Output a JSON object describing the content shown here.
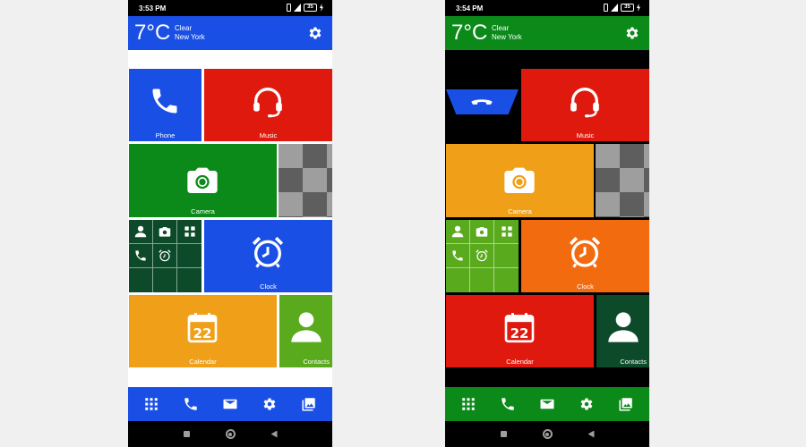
{
  "screens": [
    {
      "status": {
        "time": "3:53 PM",
        "battery": "35"
      },
      "weather": {
        "temp": "7°C",
        "condition": "Clear",
        "city": "New York"
      },
      "colors": {
        "header": "#1a4fe6",
        "content_bg": "#ffffff",
        "dock": "#1a4fe6"
      },
      "tiles": {
        "phone": "Phone",
        "music": "Music",
        "camera": "Camera",
        "clock": "Clock",
        "calendar": "Calendar",
        "contacts": "Contacts",
        "calendar_day": "22"
      }
    },
    {
      "status": {
        "time": "3:54 PM",
        "battery": "35"
      },
      "weather": {
        "temp": "7°C",
        "condition": "Clear",
        "city": "New York"
      },
      "colors": {
        "header": "#0b8a1a",
        "content_bg": "#000000",
        "dock": "#0b8a1a"
      },
      "tiles": {
        "music": "Music",
        "camera": "Camera",
        "clock": "Clock",
        "calendar": "Calendar",
        "contacts": "Contacts",
        "calendar_day": "22"
      }
    }
  ],
  "dock_icons": [
    "apps-grid-icon",
    "phone-icon",
    "mail-icon",
    "settings-icon",
    "gallery-icon"
  ]
}
